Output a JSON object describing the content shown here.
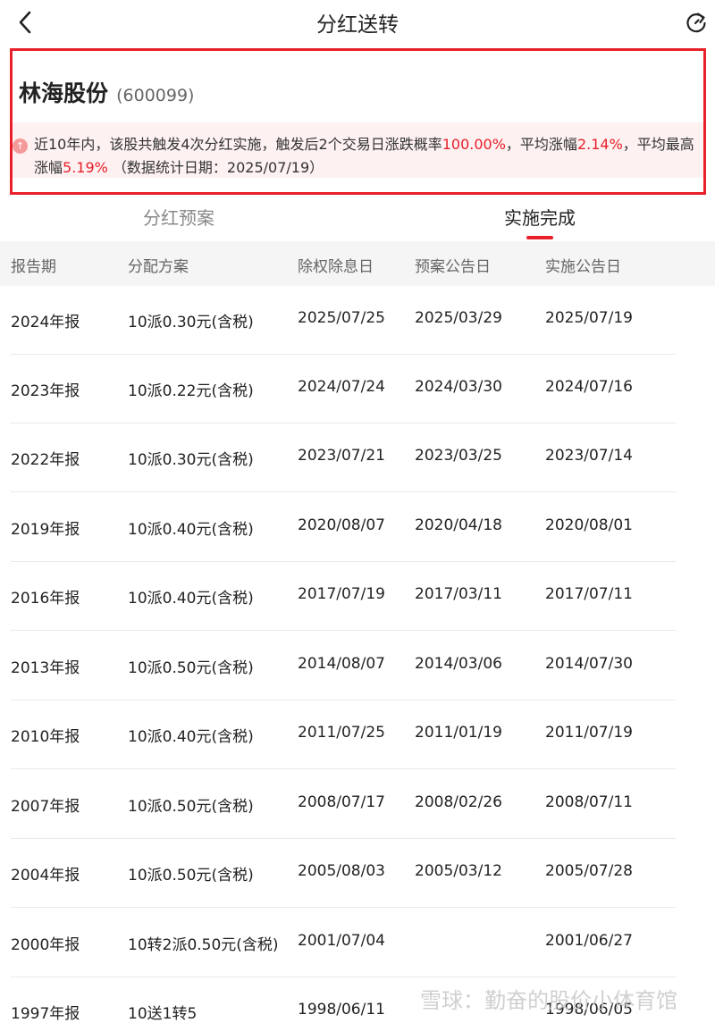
{
  "header": {
    "title": "分红送转"
  },
  "stock": {
    "name": "林海股份",
    "code": "(600099)"
  },
  "summary": {
    "icon_glyph": "↑",
    "t1": "近10年内，该股共触发4次分红实施，触发后2个交易日涨跌概率",
    "v1": "100.00%",
    "t2": "，平均涨幅",
    "v2": "2.14%",
    "t3": "，平均最高涨幅",
    "v3": "5.19%",
    "t4": " （数据统计日期：2025/07/19）"
  },
  "tabs": [
    {
      "label": "分红预案"
    },
    {
      "label": "实施完成"
    }
  ],
  "table": {
    "columns": [
      "报告期",
      "分配方案",
      "除权除息日",
      "预案公告日",
      "实施公告日"
    ],
    "rows": [
      [
        "2024年报",
        "10派0.30元(含税)",
        "2025/07/25",
        "2025/03/29",
        "2025/07/19"
      ],
      [
        "2023年报",
        "10派0.22元(含税)",
        "2024/07/24",
        "2024/03/30",
        "2024/07/16"
      ],
      [
        "2022年报",
        "10派0.30元(含税)",
        "2023/07/21",
        "2023/03/25",
        "2023/07/14"
      ],
      [
        "2019年报",
        "10派0.40元(含税)",
        "2020/08/07",
        "2020/04/18",
        "2020/08/01"
      ],
      [
        "2016年报",
        "10派0.40元(含税)",
        "2017/07/19",
        "2017/03/11",
        "2017/07/11"
      ],
      [
        "2013年报",
        "10派0.50元(含税)",
        "2014/08/07",
        "2014/03/06",
        "2014/07/30"
      ],
      [
        "2010年报",
        "10派0.40元(含税)",
        "2011/07/25",
        "2011/01/19",
        "2011/07/19"
      ],
      [
        "2007年报",
        "10派0.50元(含税)",
        "2008/07/17",
        "2008/02/26",
        "2008/07/11"
      ],
      [
        "2004年报",
        "10派0.50元(含税)",
        "2005/08/03",
        "2005/03/12",
        "2005/07/28"
      ],
      [
        "2000年报",
        "10转2派0.50元(含税)",
        "2001/07/04",
        "",
        "2001/06/27"
      ],
      [
        "1997年报",
        "10送1转5",
        "1998/06/11",
        "",
        "1998/06/05"
      ]
    ]
  },
  "watermark": "雪球：勤奋的股价小体育馆",
  "colors": {
    "accent": "#e8202a",
    "note_bg": "#fdf1f1",
    "header_bg": "#f5f5f5"
  }
}
